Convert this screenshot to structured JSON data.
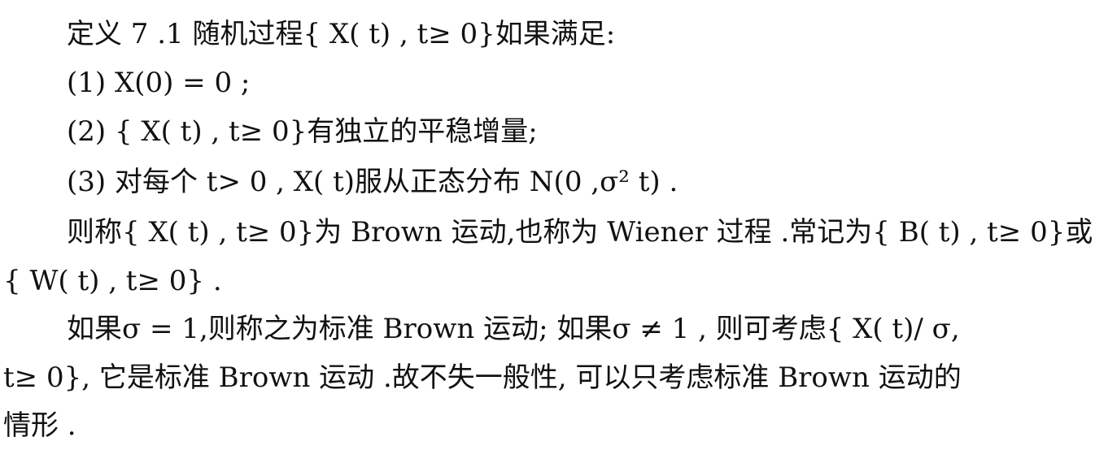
{
  "document": {
    "lines": [
      "定义 7 .1    随机过程{ X( t) , t≥ 0}如果满足:",
      "(1)  X(0) = 0 ;",
      "(2) { X( t) , t≥ 0}有独立的平稳增量;",
      "(3) 对每个  t> 0 , X( t)服从正态分布  N(0 ,σ² t)  .",
      "则称{ X( t) , t≥ 0}为 Brown 运动,也称为 Wiener 过程  .常记为{ B( t) , t≥ 0}或",
      "{ W( t) , t≥ 0}  .",
      "如果σ = 1,则称之为标准 Brown 运动; 如果σ ≠ 1 , 则可考虑{ X( t)/ σ,",
      "t≥ 0}, 它是标准 Brown 运动  .故不失一般性, 可以只考虑标准 Brown 运动的",
      "情形  ."
    ]
  }
}
